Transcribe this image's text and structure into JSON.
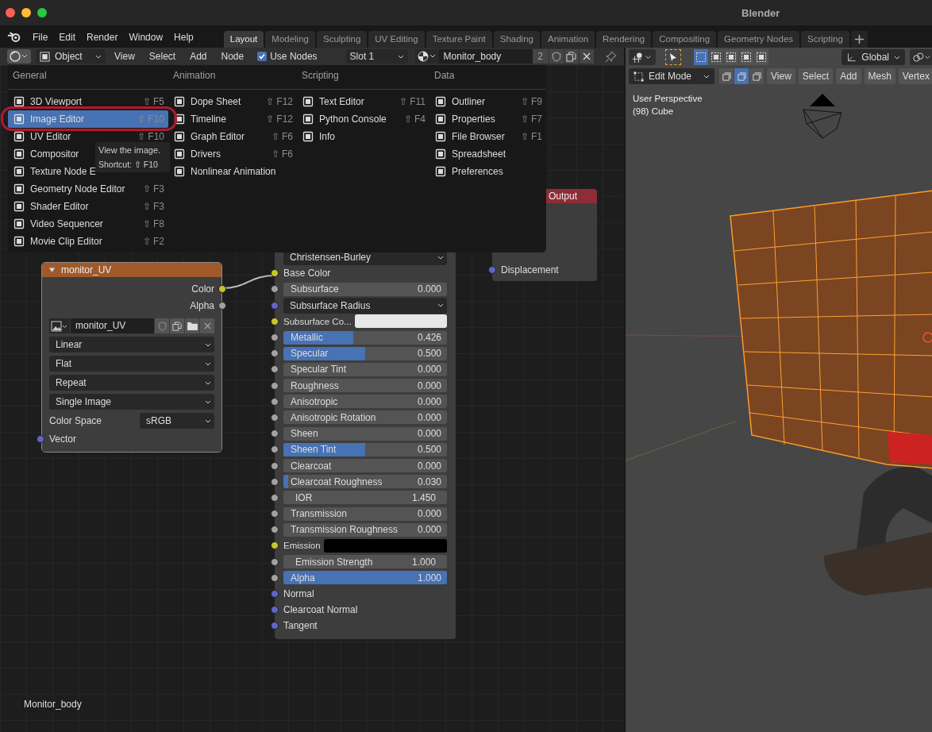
{
  "window": {
    "title": "Blender"
  },
  "menu_bar": [
    "File",
    "Edit",
    "Render",
    "Window",
    "Help"
  ],
  "workspace_tabs": [
    {
      "label": "Layout",
      "selected": true
    },
    {
      "label": "Modeling",
      "selected": false
    },
    {
      "label": "Sculpting",
      "selected": false
    },
    {
      "label": "UV Editing",
      "selected": false
    },
    {
      "label": "Texture Paint",
      "selected": false
    },
    {
      "label": "Shading",
      "selected": false
    },
    {
      "label": "Animation",
      "selected": false
    },
    {
      "label": "Rendering",
      "selected": false
    },
    {
      "label": "Compositing",
      "selected": false
    },
    {
      "label": "Geometry Nodes",
      "selected": false
    },
    {
      "label": "Scripting",
      "selected": false
    }
  ],
  "node_editor": {
    "header": {
      "mode": "Object",
      "menus": [
        "View",
        "Select",
        "Add",
        "Node"
      ],
      "use_nodes": {
        "label": "Use Nodes",
        "checked": true
      },
      "slot": "Slot 1",
      "material_name": "Monitor_body",
      "user_count": "2"
    },
    "editor_type_menu": {
      "columns": [
        {
          "heading": "General",
          "items": [
            {
              "label": "3D Viewport",
              "shortcut": "⇧ F5",
              "selected": false
            },
            {
              "label": "Image Editor",
              "shortcut": "⇧ F10",
              "selected": true
            },
            {
              "label": "UV Editor",
              "shortcut": "⇧ F10",
              "selected": false
            },
            {
              "label": "Compositor",
              "selected": false
            },
            {
              "label": "Texture Node E",
              "selected": false
            },
            {
              "label": "Geometry Node Editor",
              "shortcut": "⇧ F3",
              "selected": false
            },
            {
              "label": "Shader Editor",
              "shortcut": "⇧ F3",
              "selected": false
            },
            {
              "label": "Video Sequencer",
              "shortcut": "⇧ F8",
              "selected": false
            },
            {
              "label": "Movie Clip Editor",
              "shortcut": "⇧ F2",
              "selected": false
            }
          ]
        },
        {
          "heading": "Animation",
          "items": [
            {
              "label": "Dope Sheet",
              "shortcut": "⇧ F12",
              "selected": false
            },
            {
              "label": "Timeline",
              "shortcut": "⇧ F12",
              "selected": false
            },
            {
              "label": "Graph Editor",
              "shortcut": "⇧ F6",
              "selected": false
            },
            {
              "label": "Drivers",
              "shortcut": "⇧ F6",
              "selected": false
            },
            {
              "label": "Nonlinear Animation",
              "selected": false
            }
          ]
        },
        {
          "heading": "Scripting",
          "items": [
            {
              "label": "Text Editor",
              "shortcut": "⇧ F11",
              "selected": false
            },
            {
              "label": "Python Console",
              "shortcut": "⇧ F4",
              "selected": false
            },
            {
              "label": "Info",
              "selected": false
            }
          ]
        },
        {
          "heading": "Data",
          "items": [
            {
              "label": "Outliner",
              "shortcut": "⇧ F9",
              "selected": false
            },
            {
              "label": "Properties",
              "shortcut": "⇧ F7",
              "selected": false
            },
            {
              "label": "File Browser",
              "shortcut": "⇧ F1",
              "selected": false
            },
            {
              "label": "Spreadsheet",
              "selected": false
            },
            {
              "label": "Preferences",
              "selected": false
            }
          ]
        }
      ]
    },
    "tooltip": {
      "description": "View the image.",
      "shortcut": "Shortcut: ⇧ F10"
    },
    "image_node": {
      "title": "monitor_UV",
      "outputs": [
        {
          "label": "Color",
          "color": "#c7c729"
        },
        {
          "label": "Alpha",
          "color": "#a1a1a1"
        }
      ],
      "image": "monitor_UV",
      "dropdowns": [
        "Linear",
        "Flat",
        "Repeat",
        "Single Image"
      ],
      "color_space": {
        "label": "Color Space",
        "value": "sRGB"
      },
      "inputs": [
        {
          "label": "Vector",
          "color": "#6363c7"
        }
      ]
    },
    "principled_node": {
      "rows": [
        {
          "kind": "dropdown",
          "label": "Christensen-Burley"
        },
        {
          "kind": "socket",
          "label": "Base Color",
          "socket": {
            "color": "#c7c729"
          }
        },
        {
          "kind": "slider",
          "label": "Subsurface",
          "value": "0.000",
          "level": 0,
          "socket": {
            "color": "#a1a1a1"
          }
        },
        {
          "kind": "dropdown",
          "label": "Subsurface Radius",
          "socket": {
            "color": "#6363c7"
          }
        },
        {
          "kind": "swatch",
          "label": "Subsurface Co...",
          "color": "#e8e8e8",
          "socket": {
            "color": "#c7c729"
          }
        },
        {
          "kind": "slider",
          "label": "Metallic",
          "value": "0.426",
          "level": 0.426,
          "socket": {
            "color": "#a1a1a1"
          }
        },
        {
          "kind": "slider",
          "label": "Specular",
          "value": "0.500",
          "level": 0.5,
          "socket": {
            "color": "#a1a1a1"
          }
        },
        {
          "kind": "slider",
          "label": "Specular Tint",
          "value": "0.000",
          "level": 0,
          "socket": {
            "color": "#a1a1a1"
          }
        },
        {
          "kind": "slider",
          "label": "Roughness",
          "value": "0.000",
          "level": 0,
          "socket": {
            "color": "#a1a1a1"
          }
        },
        {
          "kind": "slider",
          "label": "Anisotropic",
          "value": "0.000",
          "level": 0,
          "socket": {
            "color": "#a1a1a1"
          }
        },
        {
          "kind": "slider",
          "label": "Anisotropic Rotation",
          "value": "0.000",
          "level": 0,
          "socket": {
            "color": "#a1a1a1"
          }
        },
        {
          "kind": "slider",
          "label": "Sheen",
          "value": "0.000",
          "level": 0,
          "socket": {
            "color": "#a1a1a1"
          }
        },
        {
          "kind": "slider",
          "label": "Sheen Tint",
          "value": "0.500",
          "level": 0.5,
          "socket": {
            "color": "#a1a1a1"
          }
        },
        {
          "kind": "slider",
          "label": "Clearcoat",
          "value": "0.000",
          "level": 0,
          "socket": {
            "color": "#a1a1a1"
          }
        },
        {
          "kind": "slider",
          "label": "Clearcoat Roughness",
          "value": "0.030",
          "level": 0.03,
          "socket": {
            "color": "#a1a1a1"
          }
        },
        {
          "kind": "number",
          "label": "IOR",
          "value": "1.450",
          "socket": {
            "color": "#a1a1a1"
          }
        },
        {
          "kind": "slider",
          "label": "Transmission",
          "value": "0.000",
          "level": 0,
          "socket": {
            "color": "#a1a1a1"
          }
        },
        {
          "kind": "slider",
          "label": "Transmission Roughness",
          "value": "0.000",
          "level": 0,
          "socket": {
            "color": "#a1a1a1"
          }
        },
        {
          "kind": "swatch",
          "label": "Emission",
          "color": "#000000",
          "socket": {
            "color": "#c7c729"
          }
        },
        {
          "kind": "number",
          "label": "Emission Strength",
          "value": "1.000",
          "socket": {
            "color": "#a1a1a1"
          }
        },
        {
          "kind": "slider",
          "label": "Alpha",
          "value": "1.000",
          "level": 1,
          "socket": {
            "color": "#a1a1a1"
          }
        },
        {
          "kind": "socket",
          "label": "Normal",
          "socket": {
            "color": "#6363c7"
          }
        },
        {
          "kind": "socket",
          "label": "Clearcoat Normal",
          "socket": {
            "color": "#6363c7"
          }
        },
        {
          "kind": "socket",
          "label": "Tangent",
          "socket": {
            "color": "#6363c7"
          }
        }
      ]
    },
    "output_node": {
      "title": "Output",
      "inputs": [
        {
          "label": "Displacement",
          "color": "#6363c7"
        }
      ]
    },
    "material_label": "Monitor_body"
  },
  "viewport": {
    "box_select_modes": [
      {
        "selected": true
      },
      {
        "selected": false
      },
      {
        "selected": false
      },
      {
        "selected": false
      },
      {
        "selected": false
      }
    ],
    "orientation": "Global",
    "mode": "Edit Mode",
    "select_modes": [
      {
        "selected": false
      },
      {
        "selected": true
      },
      {
        "selected": false
      }
    ],
    "menus": [
      "View",
      "Select",
      "Add",
      "Mesh",
      "Vertex"
    ],
    "perspective": "User Perspective",
    "object": "(98) Cube"
  }
}
